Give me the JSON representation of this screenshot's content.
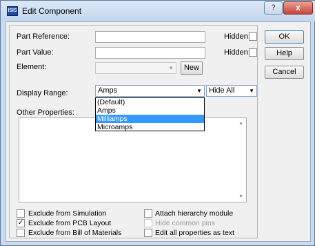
{
  "window": {
    "title": "Edit Component",
    "icon_text": "ISIS",
    "help_glyph": "?",
    "close_glyph": "x"
  },
  "fields": {
    "part_reference_label": "Part Reference:",
    "part_value_label": "Part Value:",
    "element_label": "Element:",
    "display_range_label": "Display Range:",
    "other_properties_label": "Other Properties:",
    "hidden_label": "Hidden:",
    "new_button": "New",
    "display_range_value": "Amps",
    "hide_all_value": "Hide All",
    "element_value": "",
    "part_reference_value": "",
    "part_value_value": ""
  },
  "dropdown": {
    "options": [
      "(Default)",
      "Amps",
      "Milliamps",
      "Microamps"
    ],
    "highlighted": "Milliamps"
  },
  "buttons": {
    "ok": "OK",
    "help": "Help",
    "cancel": "Cancel"
  },
  "options": {
    "exclude_simulation": "Exclude from Simulation",
    "exclude_pcb": "Exclude from PCB Layout",
    "exclude_bom": "Exclude from Bill of Materials",
    "attach_hierarchy": "Attach hierarchy module",
    "hide_common_pins": "Hide common pins",
    "edit_all_properties": "Edit all properties as text"
  },
  "checked": {
    "exclude_pcb": "✓"
  },
  "icons": [
    "dropdown-arrow-icon",
    "checkmark-icon",
    "scroll-up-icon",
    "scroll-down-icon"
  ]
}
